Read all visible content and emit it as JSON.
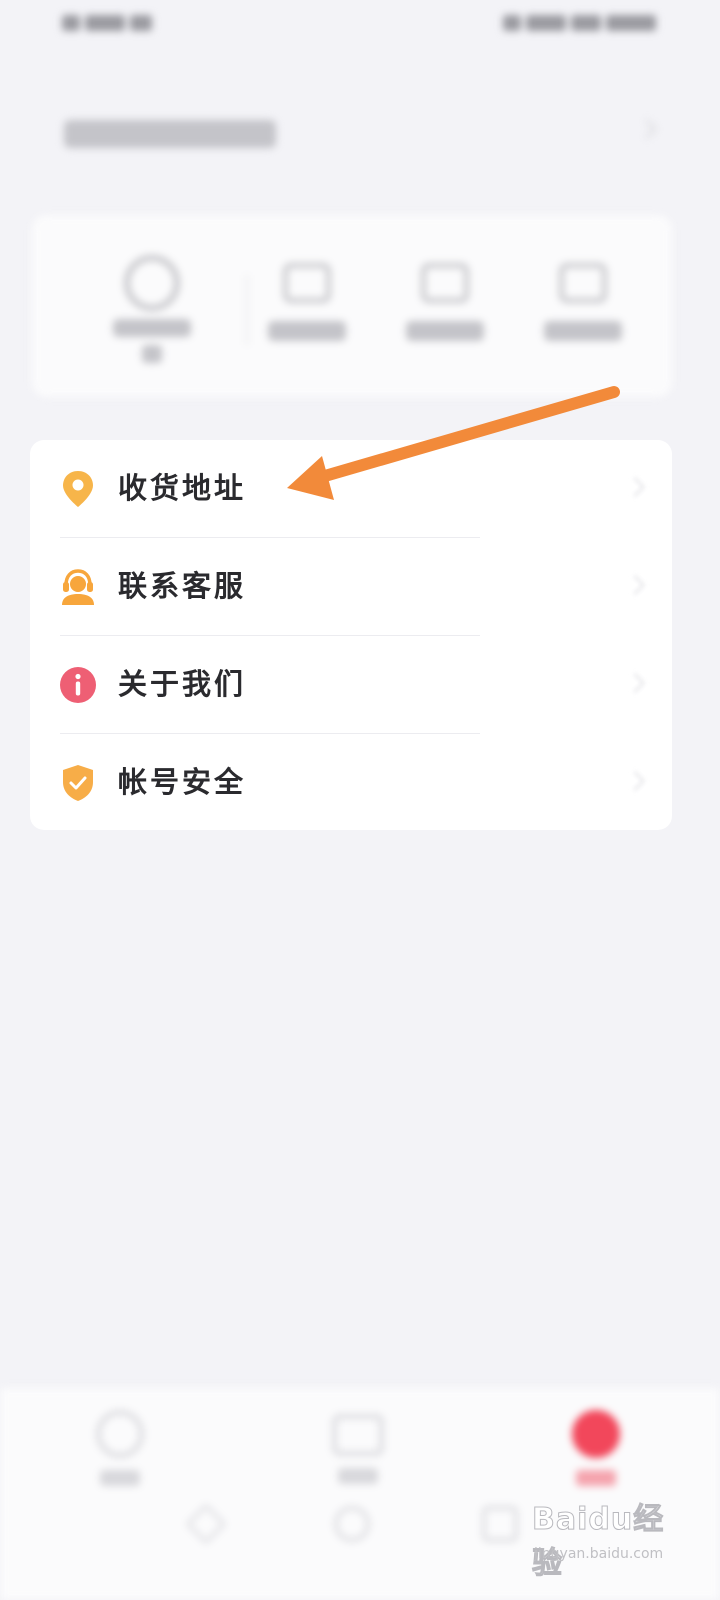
{
  "menu": {
    "items": [
      {
        "label": "收货地址",
        "icon": "location-pin-icon",
        "color": "#f7b54a"
      },
      {
        "label": "联系客服",
        "icon": "customer-service-icon",
        "color": "#f7a63c"
      },
      {
        "label": "关于我们",
        "icon": "info-icon",
        "color": "#ee5f74"
      },
      {
        "label": "帐号安全",
        "icon": "shield-check-icon",
        "color": "#f7ad48"
      }
    ]
  },
  "annotation": {
    "color": "#f28a3a",
    "target": "收货地址"
  },
  "bottom_nav": {
    "active_index": 2,
    "active_color": "#f2475b"
  },
  "watermark": {
    "text": "Baidu经验",
    "url": "jingyan.baidu.com"
  }
}
